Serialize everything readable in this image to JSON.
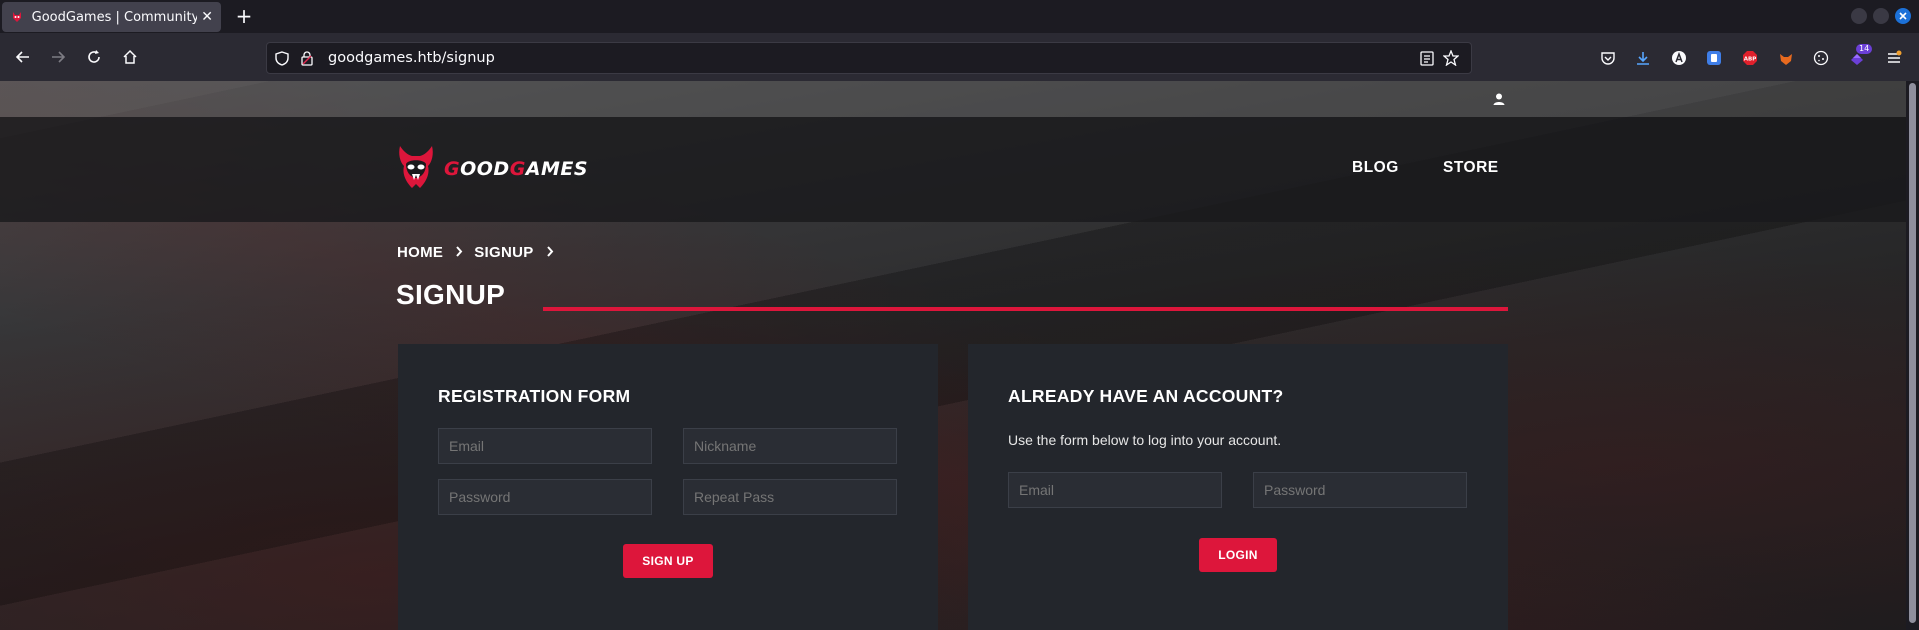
{
  "browser": {
    "tab_title": "GoodGames | Community",
    "url": "goodgames.htb/signup",
    "badge_count": "14"
  },
  "site": {
    "logo_part1": "G",
    "logo_part2": "OOD",
    "logo_part3": "G",
    "logo_part4": "AMES",
    "nav": [
      {
        "label": "BLOG"
      },
      {
        "label": "STORE"
      }
    ]
  },
  "breadcrumb": {
    "items": [
      "HOME",
      "SIGNUP"
    ]
  },
  "page_title": "SIGNUP",
  "registration": {
    "heading": "REGISTRATION FORM",
    "email_placeholder": "Email",
    "nickname_placeholder": "Nickname",
    "password_placeholder": "Password",
    "repeat_placeholder": "Repeat Pass",
    "submit_label": "SIGN UP"
  },
  "login": {
    "heading": "ALREADY HAVE AN ACCOUNT?",
    "description": "Use the form below to log into your account.",
    "email_placeholder": "Email",
    "password_placeholder": "Password",
    "submit_label": "LOGIN"
  },
  "colors": {
    "accent": "#dd163b",
    "panel": "#23262c"
  }
}
